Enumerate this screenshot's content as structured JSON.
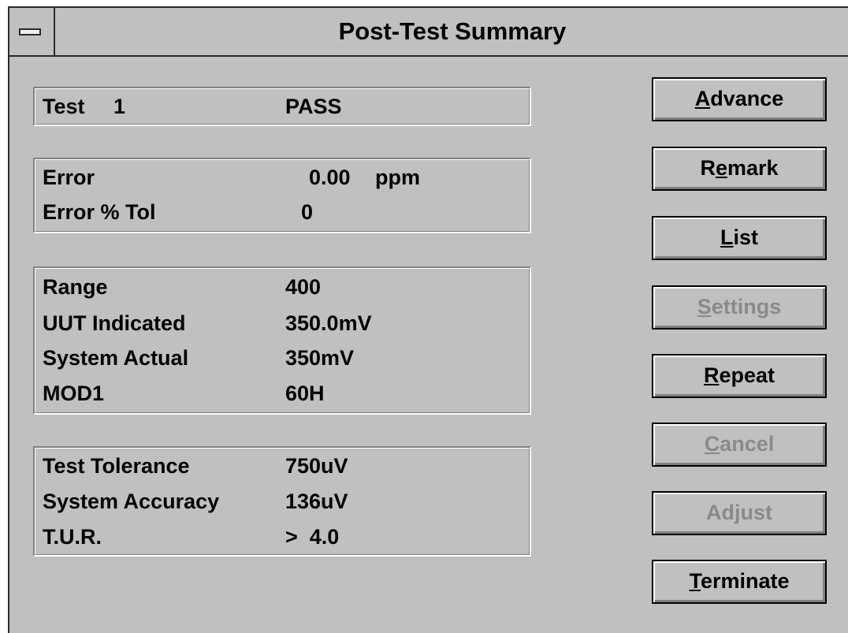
{
  "window": {
    "title": "Post-Test Summary"
  },
  "test_box": {
    "label": "Test",
    "number": "1",
    "result": "PASS"
  },
  "error_box": {
    "error_label": "Error",
    "error_value": "0.00",
    "error_unit": "ppm",
    "tol_label": "Error % Tol",
    "tol_value": "0"
  },
  "meas_box": {
    "rows": [
      {
        "label": "Range",
        "value": "400"
      },
      {
        "label": "UUT Indicated",
        "value": "350.0mV"
      },
      {
        "label": "System Actual",
        "value": "350mV"
      },
      {
        "label": "MOD1",
        "value": "60H"
      }
    ]
  },
  "tol_box": {
    "rows": [
      {
        "label": "Test Tolerance",
        "value": "750uV"
      },
      {
        "label": "System Accuracy",
        "value": "136uV"
      },
      {
        "label": "T.U.R.",
        "value": ">  4.0"
      }
    ]
  },
  "buttons": [
    {
      "pre": "",
      "key": "A",
      "post": "dvance",
      "enabled": true
    },
    {
      "pre": "R",
      "key": "e",
      "post": "mark",
      "enabled": true
    },
    {
      "pre": "",
      "key": "L",
      "post": "ist",
      "enabled": true
    },
    {
      "pre": "",
      "key": "S",
      "post": "ettings",
      "enabled": false
    },
    {
      "pre": "",
      "key": "R",
      "post": "epeat",
      "enabled": true
    },
    {
      "pre": "",
      "key": "C",
      "post": "ancel",
      "enabled": false
    },
    {
      "pre": "Ad",
      "key": "j",
      "post": "ust",
      "enabled": false
    },
    {
      "pre": "",
      "key": "T",
      "post": "erminate",
      "enabled": true
    }
  ]
}
